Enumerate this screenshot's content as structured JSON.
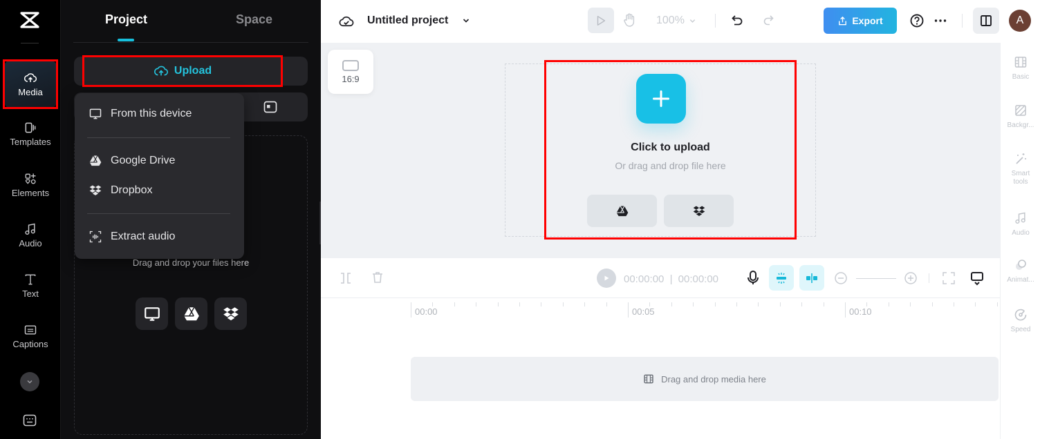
{
  "rail": {
    "items": [
      {
        "label": "Media",
        "icon": "cloud-upload-icon",
        "active": true
      },
      {
        "label": "Templates",
        "icon": "templates-icon"
      },
      {
        "label": "Elements",
        "icon": "elements-icon"
      },
      {
        "label": "Audio",
        "icon": "music-note-icon"
      },
      {
        "label": "Text",
        "icon": "text-icon"
      },
      {
        "label": "Captions",
        "icon": "captions-icon"
      }
    ]
  },
  "panel": {
    "tabs": [
      {
        "label": "Project",
        "active": true
      },
      {
        "label": "Space",
        "active": false
      }
    ],
    "upload_label": "Upload",
    "dropzone_text": "Drag and drop your files here",
    "menu": {
      "items": [
        {
          "label": "From this device",
          "icon": "monitor-icon"
        },
        {
          "label": "Google Drive",
          "icon": "google-drive-icon"
        },
        {
          "label": "Dropbox",
          "icon": "dropbox-icon"
        },
        {
          "label": "Extract audio",
          "icon": "extract-audio-icon"
        }
      ]
    }
  },
  "topbar": {
    "project_title": "Untitled project",
    "zoom_level": "100%",
    "export_label": "Export",
    "avatar_initial": "A"
  },
  "canvas": {
    "aspect_ratio": "16:9",
    "upload_title": "Click to upload",
    "upload_subtitle": "Or drag and drop file here"
  },
  "right_rail": {
    "items": [
      {
        "label": "Basic",
        "icon": "film-icon"
      },
      {
        "label": "Backgr...",
        "icon": "background-icon"
      },
      {
        "label": "Smart tools",
        "icon": "magic-wand-icon"
      },
      {
        "label": "Audio",
        "icon": "music-note-icon"
      },
      {
        "label": "Animat...",
        "icon": "animation-icon"
      },
      {
        "label": "Speed",
        "icon": "speed-icon"
      }
    ]
  },
  "timeline": {
    "current_time": "00:00:00",
    "total_time": "00:00:00",
    "ruler_labels": [
      "00:00",
      "00:05",
      "00:10"
    ],
    "track_placeholder": "Drag and drop media here"
  },
  "colors": {
    "accent": "#18c0e6",
    "export_start": "#3f8ef0",
    "export_end": "#22b4e0",
    "highlight": "#ff0000"
  }
}
